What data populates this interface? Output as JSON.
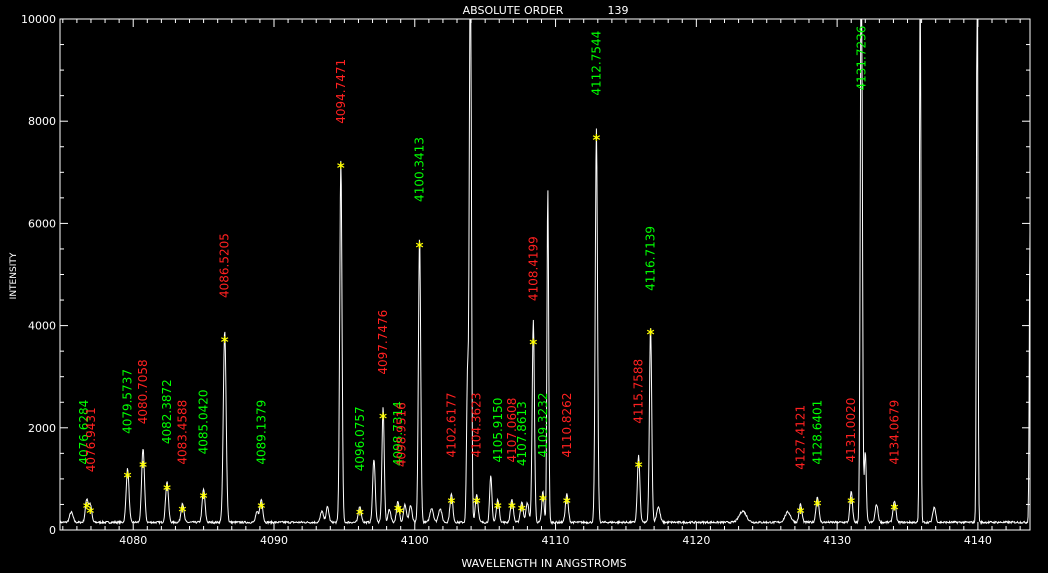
{
  "chart_data": {
    "type": "line",
    "title": "ABSOLUTE ORDER",
    "order_number": "139",
    "xlabel": "WAVELENGTH IN ANGSTROMS",
    "ylabel": "INTENSITY",
    "xlim": [
      4074.8,
      4143.7
    ],
    "ylim": [
      0,
      10000
    ],
    "xticks": [
      4080,
      4090,
      4100,
      4110,
      4120,
      4130,
      4140
    ],
    "xtick_labels": [
      "4080",
      "4090",
      "4100",
      "4110",
      "4120",
      "4130",
      "4140"
    ],
    "yticks": [
      0,
      2000,
      4000,
      6000,
      8000,
      10000
    ],
    "ytick_labels": [
      "0",
      "2000",
      "4000",
      "6000",
      "8000",
      "10000"
    ],
    "colors": {
      "background": "#000000",
      "spectrum": "#ffffff",
      "marker": "#ffff00",
      "green": "#00ff00",
      "red": "#ff2020"
    },
    "baseline": 150,
    "peaks": [
      {
        "x": 4075.6,
        "y": 200,
        "w": 0.12
      },
      {
        "x": 4076.7,
        "y": 450,
        "w": 0.1
      },
      {
        "x": 4076.95,
        "y": 350,
        "w": 0.1
      },
      {
        "x": 4079.6,
        "y": 1050,
        "w": 0.1
      },
      {
        "x": 4080.7,
        "y": 1450,
        "w": 0.1
      },
      {
        "x": 4082.4,
        "y": 800,
        "w": 0.1
      },
      {
        "x": 4083.5,
        "y": 380,
        "w": 0.1
      },
      {
        "x": 4085.0,
        "y": 650,
        "w": 0.1
      },
      {
        "x": 4086.5,
        "y": 3750,
        "w": 0.1
      },
      {
        "x": 4088.8,
        "y": 200,
        "w": 0.1
      },
      {
        "x": 4089.1,
        "y": 450,
        "w": 0.1
      },
      {
        "x": 4093.4,
        "y": 220,
        "w": 0.1
      },
      {
        "x": 4093.8,
        "y": 300,
        "w": 0.1
      },
      {
        "x": 4094.75,
        "y": 7100,
        "w": 0.08
      },
      {
        "x": 4096.1,
        "y": 320,
        "w": 0.1
      },
      {
        "x": 4097.1,
        "y": 1250,
        "w": 0.09
      },
      {
        "x": 4097.75,
        "y": 2250,
        "w": 0.08
      },
      {
        "x": 4098.2,
        "y": 250,
        "w": 0.1
      },
      {
        "x": 4098.8,
        "y": 400,
        "w": 0.1
      },
      {
        "x": 4099.3,
        "y": 350,
        "w": 0.1
      },
      {
        "x": 4099.7,
        "y": 330,
        "w": 0.1
      },
      {
        "x": 4100.34,
        "y": 5600,
        "w": 0.08
      },
      {
        "x": 4101.2,
        "y": 280,
        "w": 0.12
      },
      {
        "x": 4101.8,
        "y": 270,
        "w": 0.12
      },
      {
        "x": 4102.6,
        "y": 550,
        "w": 0.1
      },
      {
        "x": 4103.75,
        "y": 2900,
        "w": 0.07
      },
      {
        "x": 4103.95,
        "y": 12000,
        "w": 0.07
      },
      {
        "x": 4104.4,
        "y": 550,
        "w": 0.1
      },
      {
        "x": 4105.4,
        "y": 900,
        "w": 0.08
      },
      {
        "x": 4105.9,
        "y": 450,
        "w": 0.1
      },
      {
        "x": 4106.9,
        "y": 450,
        "w": 0.1
      },
      {
        "x": 4107.6,
        "y": 400,
        "w": 0.1
      },
      {
        "x": 4108.0,
        "y": 380,
        "w": 0.1
      },
      {
        "x": 4108.42,
        "y": 3950,
        "w": 0.08
      },
      {
        "x": 4109.1,
        "y": 600,
        "w": 0.08
      },
      {
        "x": 4109.45,
        "y": 6550,
        "w": 0.06
      },
      {
        "x": 4110.8,
        "y": 550,
        "w": 0.1
      },
      {
        "x": 4112.9,
        "y": 7700,
        "w": 0.08
      },
      {
        "x": 4115.9,
        "y": 1300,
        "w": 0.09
      },
      {
        "x": 4116.75,
        "y": 3850,
        "w": 0.08
      },
      {
        "x": 4117.3,
        "y": 300,
        "w": 0.12
      },
      {
        "x": 4123.3,
        "y": 220,
        "w": 0.25
      },
      {
        "x": 4126.5,
        "y": 200,
        "w": 0.2
      },
      {
        "x": 4127.4,
        "y": 350,
        "w": 0.1
      },
      {
        "x": 4128.6,
        "y": 500,
        "w": 0.1
      },
      {
        "x": 4131.0,
        "y": 600,
        "w": 0.09
      },
      {
        "x": 4131.72,
        "y": 12000,
        "w": 0.07
      },
      {
        "x": 4132.0,
        "y": 1400,
        "w": 0.07
      },
      {
        "x": 4132.8,
        "y": 350,
        "w": 0.1
      },
      {
        "x": 4134.07,
        "y": 420,
        "w": 0.1
      },
      {
        "x": 4135.9,
        "y": 12000,
        "w": 0.05
      },
      {
        "x": 4136.9,
        "y": 300,
        "w": 0.1
      },
      {
        "x": 4139.95,
        "y": 12000,
        "w": 0.05
      },
      {
        "x": 4143.7,
        "y": 5700,
        "w": 0.05
      }
    ],
    "markers": [
      {
        "x": 4076.7,
        "y": 450
      },
      {
        "x": 4076.95,
        "y": 350
      },
      {
        "x": 4079.6,
        "y": 1050
      },
      {
        "x": 4080.7,
        "y": 1250
      },
      {
        "x": 4082.4,
        "y": 800
      },
      {
        "x": 4083.5,
        "y": 380
      },
      {
        "x": 4085.0,
        "y": 650
      },
      {
        "x": 4086.5,
        "y": 3700
      },
      {
        "x": 4089.1,
        "y": 450
      },
      {
        "x": 4094.75,
        "y": 7100
      },
      {
        "x": 4096.1,
        "y": 320
      },
      {
        "x": 4097.75,
        "y": 2200
      },
      {
        "x": 4098.8,
        "y": 400
      },
      {
        "x": 4098.95,
        "y": 350
      },
      {
        "x": 4100.34,
        "y": 5550
      },
      {
        "x": 4102.6,
        "y": 550
      },
      {
        "x": 4104.4,
        "y": 550
      },
      {
        "x": 4105.9,
        "y": 450
      },
      {
        "x": 4106.9,
        "y": 450
      },
      {
        "x": 4107.6,
        "y": 400
      },
      {
        "x": 4108.42,
        "y": 3650
      },
      {
        "x": 4109.1,
        "y": 600
      },
      {
        "x": 4110.8,
        "y": 550
      },
      {
        "x": 4112.9,
        "y": 7650
      },
      {
        "x": 4115.9,
        "y": 1250
      },
      {
        "x": 4116.75,
        "y": 3850
      },
      {
        "x": 4127.4,
        "y": 350
      },
      {
        "x": 4128.6,
        "y": 500
      },
      {
        "x": 4131.0,
        "y": 550
      },
      {
        "x": 4134.07,
        "y": 420
      }
    ],
    "annotations": [
      {
        "text": "4076.6284",
        "x": 4076.5,
        "y": 1280,
        "color": "green"
      },
      {
        "text": "4076.9431",
        "x": 4077.0,
        "y": 1130,
        "color": "red"
      },
      {
        "text": "4079.5737",
        "x": 4079.6,
        "y": 1880,
        "color": "green"
      },
      {
        "text": "4080.7058",
        "x": 4080.7,
        "y": 2070,
        "color": "red"
      },
      {
        "text": "4082.3872",
        "x": 4082.4,
        "y": 1680,
        "color": "green"
      },
      {
        "text": "4083.4588",
        "x": 4083.5,
        "y": 1280,
        "color": "red"
      },
      {
        "text": "4085.0420",
        "x": 4085.0,
        "y": 1480,
        "color": "green"
      },
      {
        "text": "4086.5205",
        "x": 4086.5,
        "y": 4540,
        "color": "red"
      },
      {
        "text": "4089.1379",
        "x": 4089.1,
        "y": 1280,
        "color": "green"
      },
      {
        "text": "4094.7471",
        "x": 4094.75,
        "y": 7950,
        "color": "red"
      },
      {
        "text": "4096.0757",
        "x": 4096.1,
        "y": 1150,
        "color": "green"
      },
      {
        "text": "4097.7476",
        "x": 4097.75,
        "y": 3040,
        "color": "red"
      },
      {
        "text": "4098.7314",
        "x": 4098.8,
        "y": 1250,
        "color": "green"
      },
      {
        "text": "4098.9516",
        "x": 4099.05,
        "y": 1230,
        "color": "red"
      },
      {
        "text": "4100.3413",
        "x": 4100.34,
        "y": 6420,
        "color": "green"
      },
      {
        "text": "4102.6177",
        "x": 4102.6,
        "y": 1420,
        "color": "red"
      },
      {
        "text": "4104.3623",
        "x": 4104.4,
        "y": 1420,
        "color": "red"
      },
      {
        "text": "4105.9150",
        "x": 4105.9,
        "y": 1320,
        "color": "green"
      },
      {
        "text": "4107.0608",
        "x": 4106.9,
        "y": 1320,
        "color": "red"
      },
      {
        "text": "4107.8613",
        "x": 4107.6,
        "y": 1250,
        "color": "green"
      },
      {
        "text": "4108.4199",
        "x": 4108.42,
        "y": 4480,
        "color": "red"
      },
      {
        "text": "4109.3232",
        "x": 4109.1,
        "y": 1420,
        "color": "green"
      },
      {
        "text": "4110.8262",
        "x": 4110.8,
        "y": 1420,
        "color": "red"
      },
      {
        "text": "4112.7544",
        "x": 4112.9,
        "y": 8500,
        "color": "green"
      },
      {
        "text": "4115.7588",
        "x": 4115.9,
        "y": 2080,
        "color": "red"
      },
      {
        "text": "4116.7139",
        "x": 4116.75,
        "y": 4680,
        "color": "green"
      },
      {
        "text": "4127.4121",
        "x": 4127.4,
        "y": 1180,
        "color": "red"
      },
      {
        "text": "4128.6401",
        "x": 4128.6,
        "y": 1280,
        "color": "green"
      },
      {
        "text": "4131.0020",
        "x": 4131.0,
        "y": 1320,
        "color": "red"
      },
      {
        "text": "4131.7236",
        "x": 4131.72,
        "y": 8600,
        "color": "green"
      },
      {
        "text": "4134.0679",
        "x": 4134.07,
        "y": 1280,
        "color": "red"
      }
    ]
  }
}
